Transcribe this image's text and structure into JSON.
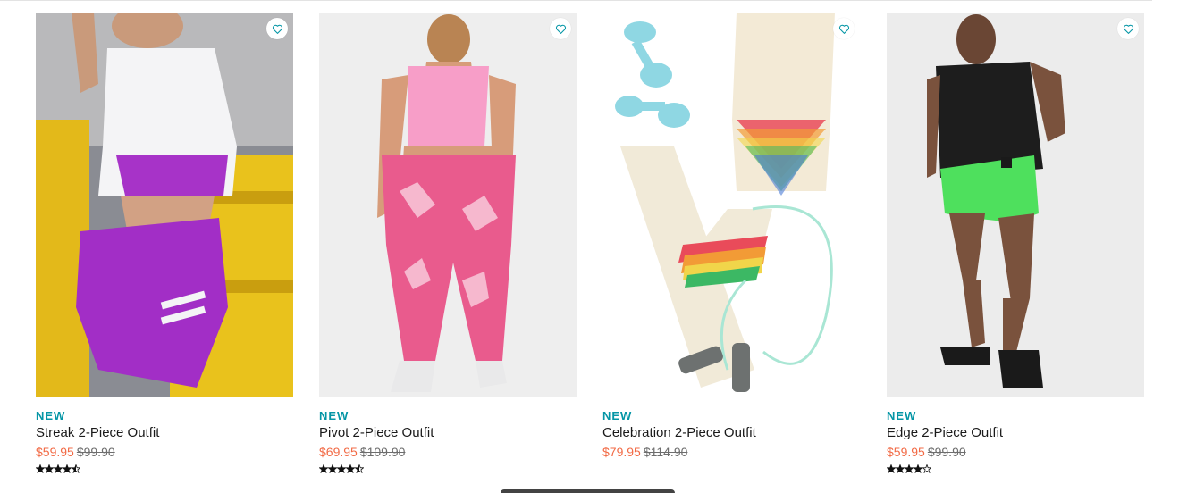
{
  "products": [
    {
      "badge": "NEW",
      "title": "Streak 2-Piece Outfit",
      "sale_price": "$59.95",
      "original_price": "$99.90",
      "rating": 4.5,
      "image": "woman-white-top-purple-shorts-yellow-rail",
      "wishlist_icon": "heart-outline-icon"
    },
    {
      "badge": "NEW",
      "title": "Pivot 2-Piece Outfit",
      "sale_price": "$69.95",
      "original_price": "$109.90",
      "rating": 4.5,
      "image": "woman-pink-snakeskin-leggings-back-view",
      "wishlist_icon": "heart-outline-icon"
    },
    {
      "badge": "NEW",
      "title": "Celebration 2-Piece Outfit",
      "sale_price": "$79.95",
      "original_price": "$114.90",
      "rating": null,
      "image": "rainbow-tie-dye-bra-leggings-dumbbells-jump-rope",
      "wishlist_icon": "heart-outline-icon"
    },
    {
      "badge": "NEW",
      "title": "Edge 2-Piece Outfit",
      "sale_price": "$59.95",
      "original_price": "$99.90",
      "rating": 4,
      "image": "woman-black-tank-green-shorts",
      "wishlist_icon": "heart-outline-icon"
    }
  ],
  "colors": {
    "badge": "#0596a6",
    "sale_price": "#f26a45",
    "original_price": "#6d6d6d",
    "heart": "#0596a6"
  }
}
